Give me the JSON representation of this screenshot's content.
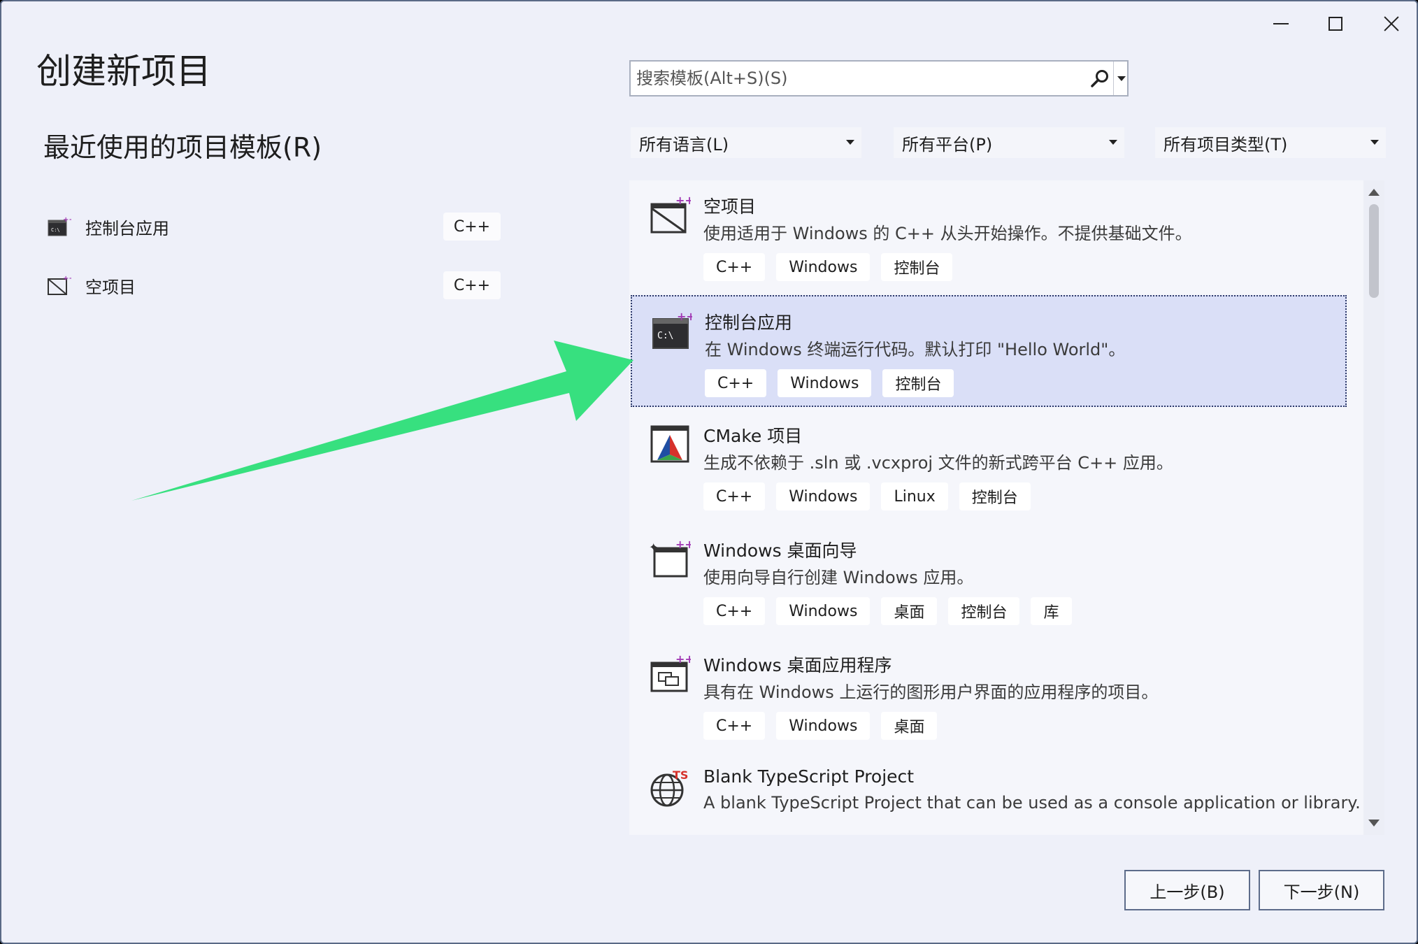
{
  "page_title": "创建新项目",
  "recent_title": "最近使用的项目模板(R)",
  "recent": [
    {
      "label": "控制台应用",
      "tag": "C++"
    },
    {
      "label": "空项目",
      "tag": "C++"
    }
  ],
  "search": {
    "placeholder": "搜索模板(Alt+S)(S)"
  },
  "filters": {
    "language": "所有语言(L)",
    "platform": "所有平台(P)",
    "project_type": "所有项目类型(T)"
  },
  "templates": [
    {
      "name": "空项目",
      "desc": "使用适用于 Windows 的 C++ 从头开始操作。不提供基础文件。",
      "tags": [
        "C++",
        "Windows",
        "控制台"
      ],
      "icon": "empty-project-icon"
    },
    {
      "name": "控制台应用",
      "desc": "在 Windows 终端运行代码。默认打印 \"Hello World\"。",
      "tags": [
        "C++",
        "Windows",
        "控制台"
      ],
      "icon": "console-app-icon"
    },
    {
      "name": "CMake 项目",
      "desc": "生成不依赖于 .sln 或 .vcxproj 文件的新式跨平台 C++ 应用。",
      "tags": [
        "C++",
        "Windows",
        "Linux",
        "控制台"
      ],
      "icon": "cmake-icon"
    },
    {
      "name": "Windows 桌面向导",
      "desc": "使用向导自行创建 Windows 应用。",
      "tags": [
        "C++",
        "Windows",
        "桌面",
        "控制台",
        "库"
      ],
      "icon": "desktop-wizard-icon"
    },
    {
      "name": "Windows 桌面应用程序",
      "desc": "具有在 Windows 上运行的图形用户界面的应用程序的项目。",
      "tags": [
        "C++",
        "Windows",
        "桌面"
      ],
      "icon": "desktop-app-icon"
    },
    {
      "name": "Blank TypeScript Project",
      "desc": "A blank TypeScript Project that can be used as a console application or library.",
      "tags": [],
      "icon": "typescript-globe-icon"
    }
  ],
  "buttons": {
    "back": "上一步(B)",
    "next": "下一步(N)"
  },
  "colors": {
    "accent_arrow": "#37e07f",
    "selected_bg": "#dadff7",
    "window_bg": "#eef0f9"
  }
}
